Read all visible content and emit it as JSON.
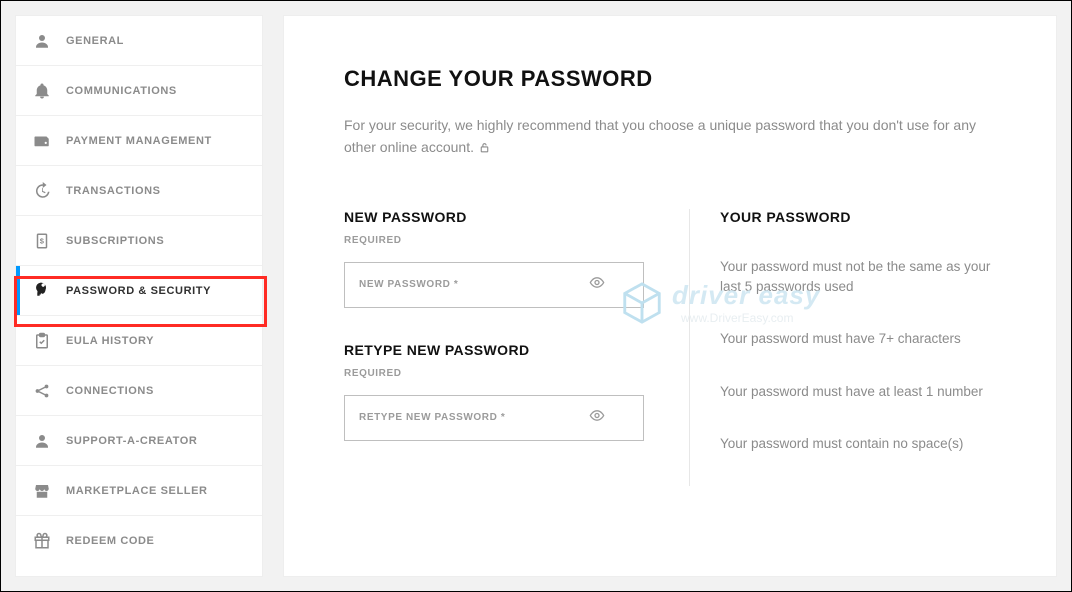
{
  "sidebar": {
    "items": [
      {
        "label": "GENERAL"
      },
      {
        "label": "COMMUNICATIONS"
      },
      {
        "label": "PAYMENT MANAGEMENT"
      },
      {
        "label": "TRANSACTIONS"
      },
      {
        "label": "SUBSCRIPTIONS"
      },
      {
        "label": "PASSWORD & SECURITY"
      },
      {
        "label": "EULA HISTORY"
      },
      {
        "label": "CONNECTIONS"
      },
      {
        "label": "SUPPORT-A-CREATOR"
      },
      {
        "label": "MARKETPLACE SELLER"
      },
      {
        "label": "REDEEM CODE"
      }
    ]
  },
  "main": {
    "title": "CHANGE YOUR PASSWORD",
    "description": "For your security, we highly recommend that you choose a unique password that you don't use for any other online account.",
    "left": {
      "new_password_label": "NEW PASSWORD",
      "new_password_required": "REQUIRED",
      "new_password_placeholder": "NEW PASSWORD *",
      "retype_label": "RETYPE NEW PASSWORD",
      "retype_required": "REQUIRED",
      "retype_placeholder": "RETYPE NEW PASSWORD *"
    },
    "right": {
      "title": "YOUR PASSWORD",
      "rules": [
        "Your password must not be the same as your last 5 passwords used",
        "Your password must have 7+ characters",
        "Your password must have at least 1 number",
        "Your password must contain no space(s)"
      ]
    }
  },
  "watermark": {
    "brand": "driver easy",
    "url": "www.DriverEasy.com"
  }
}
